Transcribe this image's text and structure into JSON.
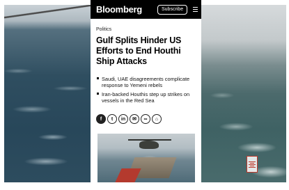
{
  "header": {
    "brand": "Bloomberg",
    "subscribe_label": "Subscribe",
    "menu_icon": "hamburger-menu-icon"
  },
  "article": {
    "section": "Politics",
    "headline": "Gulf Splits Hinder US Efforts to End Houthi Ship Attacks",
    "bullets": [
      "Saudi, UAE disagreements complicate response to Yemeni rebels",
      "Iran-backed Houthis step up strikes on vessels in the Red Sea"
    ]
  },
  "share": {
    "icons": [
      "facebook-icon",
      "twitter-icon",
      "linkedin-icon",
      "email-icon",
      "link-icon",
      "gift-icon"
    ],
    "glyphs": [
      "f",
      "t",
      "in",
      "✉",
      "∞",
      "⌂"
    ]
  },
  "colors": {
    "topbar": "#000000",
    "sea": "#2f4e60"
  }
}
